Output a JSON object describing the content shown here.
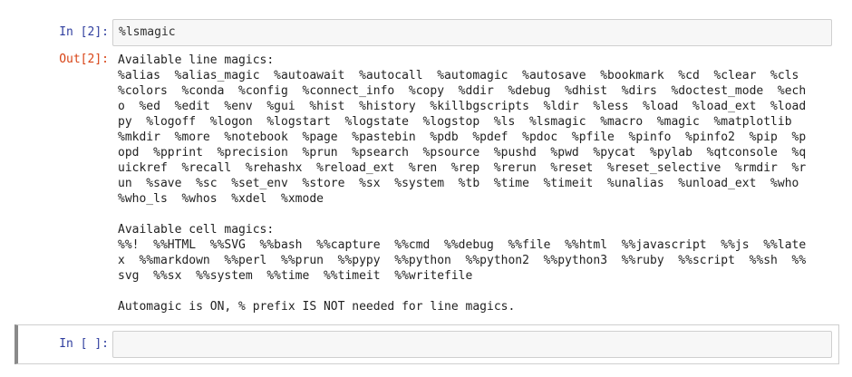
{
  "cells": [
    {
      "in_prompt": "In [2]:",
      "code": "%lsmagic",
      "out_prompt": "Out[2]:",
      "output_lines": [
        "Available line magics:",
        "%alias  %alias_magic  %autoawait  %autocall  %automagic  %autosave  %bookmark  %cd  %clear  %cls",
        "%colors  %conda  %config  %connect_info  %copy  %ddir  %debug  %dhist  %dirs  %doctest_mode  %ech",
        "o  %ed  %edit  %env  %gui  %hist  %history  %killbgscripts  %ldir  %less  %load  %load_ext  %load",
        "py  %logoff  %logon  %logstart  %logstate  %logstop  %ls  %lsmagic  %macro  %magic  %matplotlib",
        "%mkdir  %more  %notebook  %page  %pastebin  %pdb  %pdef  %pdoc  %pfile  %pinfo  %pinfo2  %pip  %p",
        "opd  %pprint  %precision  %prun  %psearch  %psource  %pushd  %pwd  %pycat  %pylab  %qtconsole  %q",
        "uickref  %recall  %rehashx  %reload_ext  %ren  %rep  %rerun  %reset  %reset_selective  %rmdir  %r",
        "un  %save  %sc  %set_env  %store  %sx  %system  %tb  %time  %timeit  %unalias  %unload_ext  %who",
        "%who_ls  %whos  %xdel  %xmode",
        "",
        "Available cell magics:",
        "%%!  %%HTML  %%SVG  %%bash  %%capture  %%cmd  %%debug  %%file  %%html  %%javascript  %%js  %%late",
        "x  %%markdown  %%perl  %%prun  %%pypy  %%python  %%python2  %%python3  %%ruby  %%script  %%sh  %%",
        "svg  %%sx  %%system  %%time  %%timeit  %%writefile",
        "",
        "Automagic is ON, % prefix IS NOT needed for line magics."
      ]
    },
    {
      "in_prompt": "In [ ]:",
      "code": ""
    }
  ],
  "colors": {
    "in_prompt": "#303f9f",
    "out_prompt": "#d84315",
    "input_bg": "#f7f7f7",
    "selected_border": "#8a8a8a"
  }
}
